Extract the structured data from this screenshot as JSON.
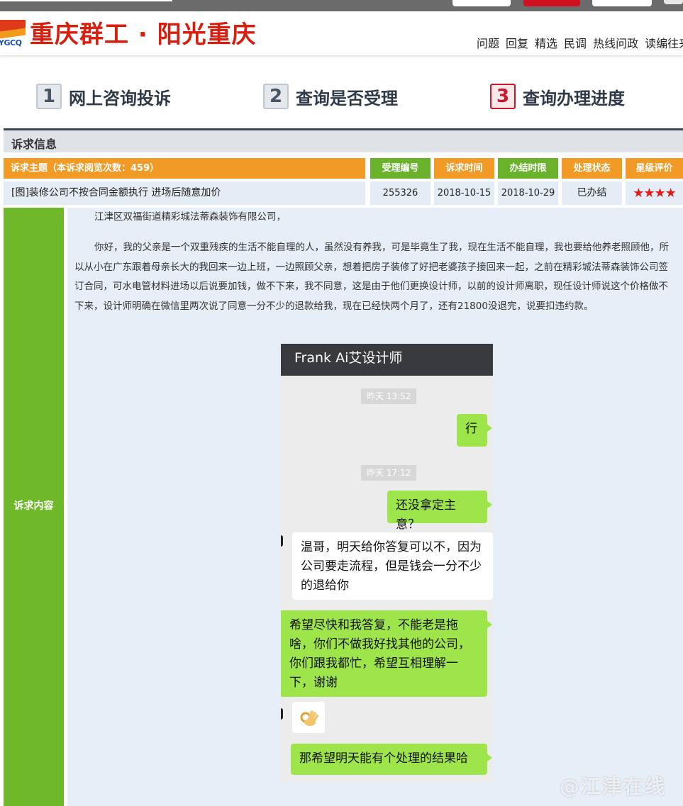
{
  "site": {
    "logo_text": "YGCQ",
    "title": "重庆群工 · 阳光重庆",
    "nav": [
      "问题",
      "回复",
      "精选",
      "民调",
      "热线问政",
      "读编往来"
    ]
  },
  "steps": [
    {
      "num": "1",
      "label": "网上咨询投诉"
    },
    {
      "num": "2",
      "label": "查询是否受理"
    },
    {
      "num": "3",
      "label": "查询办理进度",
      "active": true
    }
  ],
  "section": {
    "title": "诉求信息"
  },
  "table": {
    "headers": {
      "topic": "诉求主题（本诉求阅览次数：459）",
      "id": "受理编号",
      "time": "诉求时间",
      "deadline": "办结时限",
      "status": "处理状态",
      "rating": "星级评价"
    },
    "row": {
      "topic": "[图]装修公司不按合同金额执行 进场后随意加价",
      "id": "255326",
      "time": "2018-10-15",
      "deadline": "2018-10-29",
      "status": "已办结",
      "rating": "★★★★"
    }
  },
  "content": {
    "label": "诉求内容",
    "addressee": "江津区双福街道精彩城法蒂森装饰有限公司，",
    "body": "你好，我的父亲是一个双重残疾的生活不能自理的人，虽然没有养我，可是毕竟生了我，现在生活不能自理，我也要给他养老照顾他，所以从小在广东跟着母亲长大的我回来一边上班，一边照顾父亲，想着把房子装修了好把老婆孩子接回来一起，之前在精彩城法蒂森装饰公司签订合同，可水电管材料进场以后说要加钱，做不下来，我不同意，这是由于他们更换设计师，以前的设计师离职，现任设计师说这个价格做不下来，设计师明确在微信里两次说了同意一分不少的退款给我，现在已经快两个月了，还有21800没退完，说要扣违约款。"
  },
  "chat": {
    "title": "Frank Ai艾设计师",
    "time1": "昨天 13:52",
    "msg1": "行",
    "time2": "昨天 17:12",
    "msg2": "还没拿定主意？",
    "msg3": "温哥，明天给你答复可以不，因为公司要走流程，但是钱会一分不少的退给你",
    "msg4": "希望尽快和我答复，不能老是拖啥，你们不做我好找其他的公司，你们跟我都忙，希望互相理解一下，谢谢",
    "msg5_icon": "ok-hand-emoji",
    "msg6": "那希望明天能有个处理的结果哈"
  },
  "watermark": "@江津在线"
}
